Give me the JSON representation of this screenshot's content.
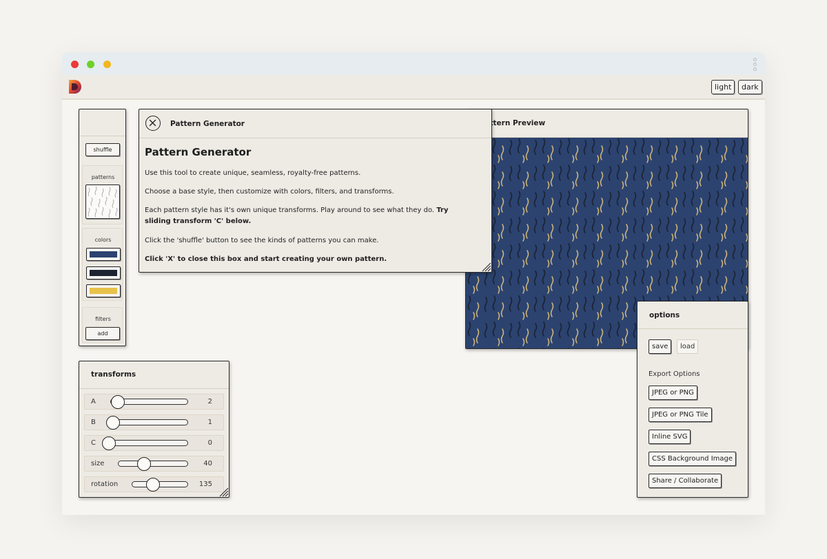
{
  "app": {
    "theme_buttons": {
      "light": "light",
      "dark": "dark"
    }
  },
  "sidebar": {
    "shuffle_label": "shuffle",
    "patterns_label": "patterns",
    "colors_label": "colors",
    "colors": [
      "#2c4370",
      "#1c2331",
      "#e8c24a"
    ],
    "filters_label": "filters",
    "add_label": "add"
  },
  "modal": {
    "header_title": "Pattern Generator",
    "heading": "Pattern Generator",
    "p1": "Use this tool to create unique, seamless, royalty-free patterns.",
    "p2": "Choose a base style, then customize with colors, filters, and transforms.",
    "p3_text": "Each pattern style has it's own unique transforms. Play around to see what they do.",
    "p3_bold": "Try sliding transform 'C' below.",
    "p4": "Click the 'shuffle' button to see the kinds of patterns you can make.",
    "p5": "Click 'X' to close this box and start creating your own pattern."
  },
  "preview": {
    "title": "Pattern Preview",
    "background": "#2c4370",
    "stroke_dark": "#1b2436",
    "stroke_gold": "#cdb57a"
  },
  "transforms": {
    "title": "transforms",
    "rows": [
      {
        "label": "A",
        "value": "2",
        "level": 0.1
      },
      {
        "label": "B",
        "value": "1",
        "level": 0.05
      },
      {
        "label": "C",
        "value": "0",
        "level": 0.0
      },
      {
        "label": "size",
        "value": "40",
        "level": 0.4
      },
      {
        "label": "rotation",
        "value": "135",
        "level": 0.375
      }
    ]
  },
  "options": {
    "title": "options",
    "save_label": "save",
    "load_label": "load",
    "export_label": "Export Options",
    "exports": [
      "JPEG or PNG",
      "JPEG or PNG Tile",
      "Inline SVG",
      "CSS Background Image",
      "Share / Collaborate"
    ]
  }
}
